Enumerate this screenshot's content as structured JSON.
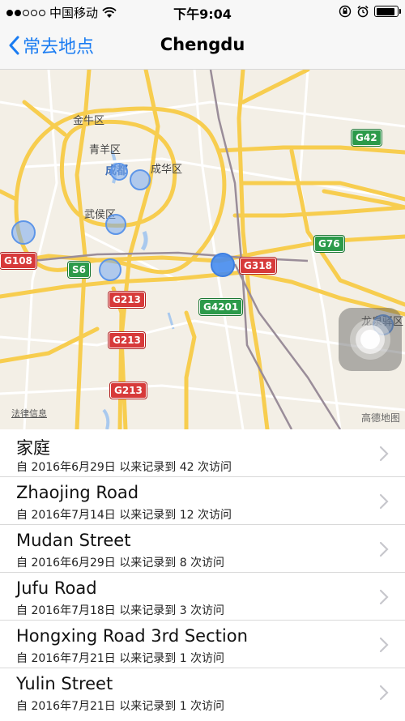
{
  "status_bar": {
    "carrier": "中国移动",
    "time": "下午9:04",
    "signal_dots_filled": 2,
    "signal_dots_total": 5,
    "battery_level": 0.9
  },
  "nav": {
    "back_label": "常去地点",
    "title": "Chengdu"
  },
  "map": {
    "district_labels": [
      "金牛区",
      "青羊区",
      "成都",
      "成华区",
      "武侯区",
      "龙泉驿区"
    ],
    "road_shields": {
      "g42": "G42",
      "g76": "G76",
      "g318": "G318",
      "g108": "G108",
      "s6": "S6",
      "g213_a": "G213",
      "g213_b": "G213",
      "g213_c": "G213",
      "g4201": "G4201"
    },
    "legal_label": "法律信息",
    "provider": "高德地图"
  },
  "places": [
    {
      "name": "家庭",
      "detail": "自 2016年6月29日 以来记录到 42 次访问"
    },
    {
      "name": "Zhaojing Road",
      "detail": "自 2016年7月14日 以来记录到 12 次访问"
    },
    {
      "name": "Mudan Street",
      "detail": "自 2016年6月29日 以来记录到 8 次访问"
    },
    {
      "name": "Jufu Road",
      "detail": "自 2016年7月18日 以来记录到 3 次访问"
    },
    {
      "name": "Hongxing Road 3rd Section",
      "detail": "自 2016年7月21日 以来记录到 1 次访问"
    },
    {
      "name": "Yulin Street",
      "detail": "自 2016年7月21日 以来记录到 1 次访问"
    }
  ],
  "colors": {
    "accent": "#1a7cf2",
    "road_major": "#f7cd4f",
    "road_minor": "#ffffff",
    "rail": "#9a8d99",
    "pin": "#5d95e8"
  }
}
